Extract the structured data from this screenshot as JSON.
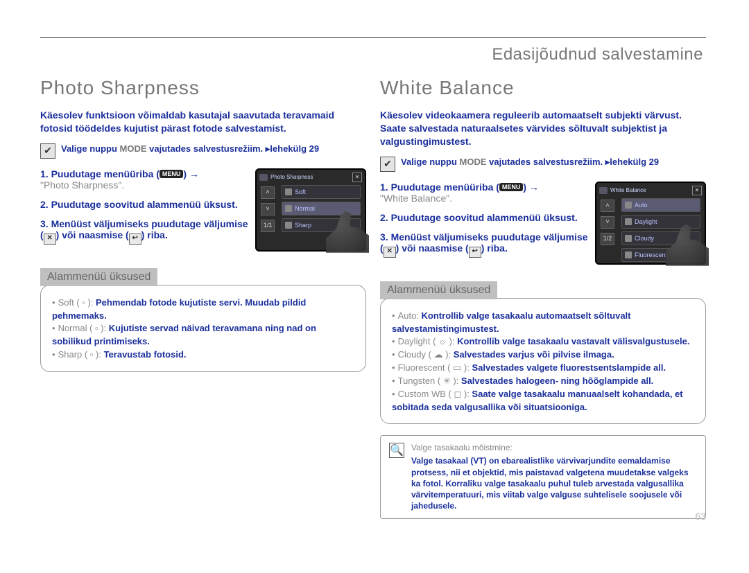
{
  "chapter": "Edasijõudnud salvestamine",
  "pageNumber": "63",
  "left": {
    "title": "Photo Sharpness",
    "intro": "Käesolev funktsioon võimaldab kasutajal saavutada teravamaid fotosid töödeldes kujutist pärast fotode salvestamist.",
    "note_pre": "Valige nuppu ",
    "note_mode": "MODE",
    "note_post": " vajutades salvestusrežiim. ▸lehekülg 29",
    "steps": {
      "s1_pre": "1. Puudutage menüüriba (",
      "s1_menu": "MENU",
      "s1_post": ") → ",
      "s1_item": "\"Photo Sharpness\".",
      "s2": "2. Puudutage soovitud alammenüü üksust.",
      "s3_a": "3. Menüüst väljumiseks puudutage väljumise (",
      "s3_x": "✕",
      "s3_b": ") või naasmise (",
      "s3_back": "↩",
      "s3_c": ") riba."
    },
    "subheader": "Alammenüü üksused",
    "bullets": {
      "b1_term": "Soft ( ▫ ): ",
      "b1_text": "Pehmendab fotode kujutiste servi. Muudab pildid pehmemaks.",
      "b2_term": "Normal ( ▫ ): ",
      "b2_text": "Kujutiste servad näivad teravamana ning nad on sobilikud printimiseks.",
      "b3_term": "Sharp ( ▫ ): ",
      "b3_text": "Teravustab fotosid."
    },
    "lcd": {
      "title": "Photo Sharpness",
      "paging": "1/1",
      "opt1": "Soft",
      "opt2": "Normal",
      "opt3": "Sharp"
    }
  },
  "right": {
    "title": "White Balance",
    "intro": "Käesolev videokaamera reguleerib automaatselt subjekti värvust. Saate salvestada naturaalsetes värvides sõltuvalt subjektist ja valgustingimustest.",
    "note_pre": "Valige nuppu ",
    "note_mode": "MODE",
    "note_post": " vajutades salvestusrežiim. ▸lehekülg 29",
    "steps": {
      "s1_pre": "1. Puudutage menüüriba (",
      "s1_menu": "MENU",
      "s1_post": ") → ",
      "s1_item": "\"White Balance\".",
      "s2": "2. Puudutage soovitud alammenüü üksust.",
      "s3_a": "3. Menüüst väljumiseks puudutage väljumise (",
      "s3_x": "✕",
      "s3_b": ") või naasmise (",
      "s3_back": "↩",
      "s3_c": ") riba."
    },
    "subheader": "Alammenüü üksused",
    "bullets": {
      "b1_term": "Auto: ",
      "b1_text": "Kontrollib valge tasakaalu automaatselt sõltuvalt salvestamistingimustest.",
      "b2_term": "Daylight ( ☼ ): ",
      "b2_text": "Kontrollib valge tasakaalu vastavalt välisvalgustusele.",
      "b3_term": "Cloudy ( ☁ ): ",
      "b3_text": "Salvestades varjus või pilvise ilmaga.",
      "b4_term": "Fluorescent ( ▭ ): ",
      "b4_text": "Salvestades valgete fluorestsentslampide all.",
      "b5_term": "Tungsten ( ✳ ): ",
      "b5_text": "Salvestades halogeen- ning hõõglampide all.",
      "b6_term": "Custom WB ( ◻ ): ",
      "b6_text": "Saate valge tasakaalu manuaalselt kohandada, et sobitada seda valgusallika või situatsiooniga."
    },
    "lcd": {
      "title": "White Balance",
      "paging": "1/2",
      "opt1": "Auto",
      "opt2": "Daylight",
      "opt3": "Cloudy",
      "opt4": "Fluorescent"
    },
    "info": {
      "title": "Valge tasakaalu mõistmine:",
      "body": "Valge tasakaal (VT) on ebarealistlike värvivarjundite eemaldamise protsess, nii et objektid, mis paistavad valgetena muudetakse valgeks ka fotol. Korraliku valge tasakaalu puhul tuleb arvestada valgusallika värvitemperatuuri, mis viitab valge valguse suhtelisele soojusele või jahedusele."
    }
  }
}
